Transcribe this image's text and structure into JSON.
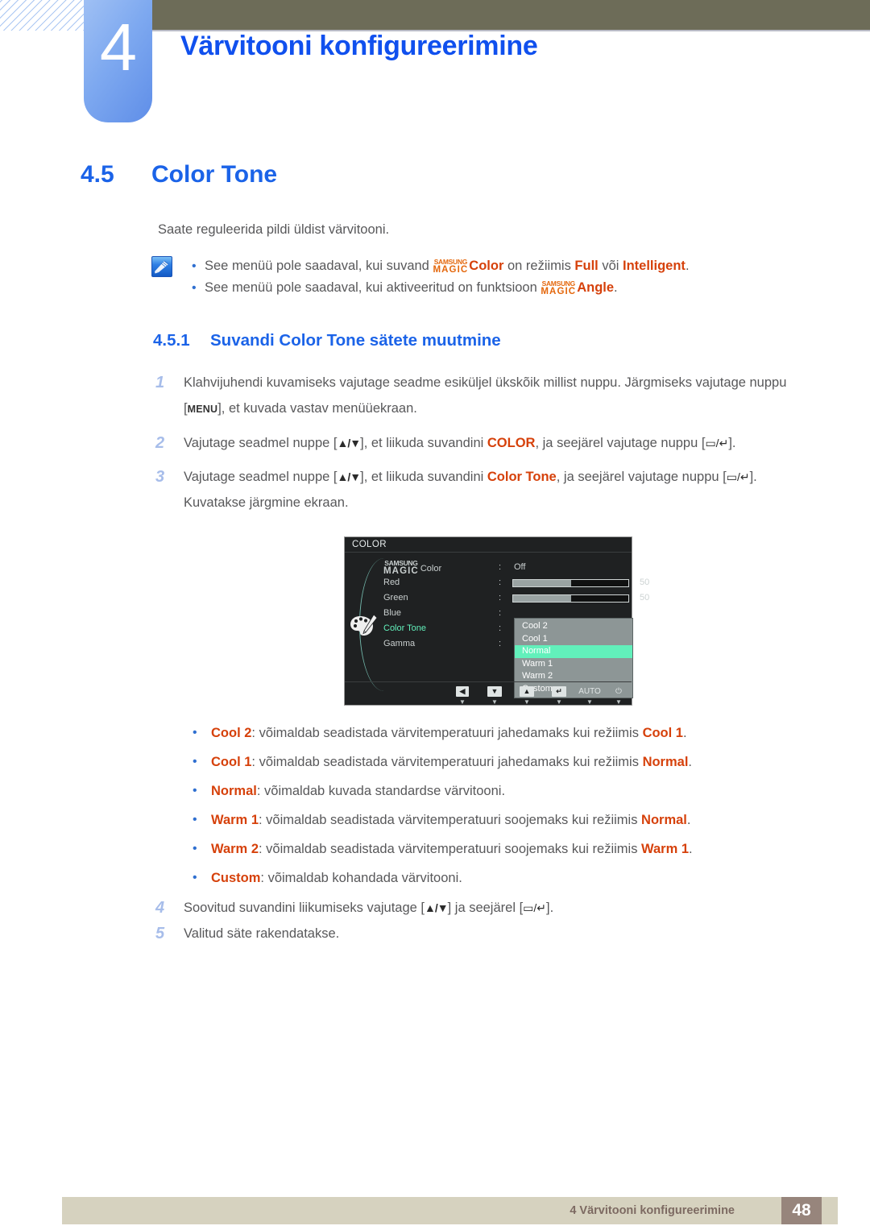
{
  "header": {
    "chapter_number": "4",
    "chapter_title": "Värvitooni konfigureerimine",
    "accent_blue": "#1050ee",
    "tab_blue": "#7ea9f0",
    "olive": "#6d6c58"
  },
  "section": {
    "number": "4.5",
    "title": "Color Tone",
    "intro": "Saate reguleerida pildi üldist värvitooni."
  },
  "note": {
    "icon": "note-pencil-icon",
    "lines": [
      {
        "pre": "See menüü pole saadaval, kui suvand ",
        "magic_top": "SAMSUNG",
        "magic_bottom": "MAGIC",
        "magic_suffix": "Color",
        "mid": " on režiimis ",
        "kw1": "Full",
        "mid2": " või ",
        "kw2": "Intelligent",
        "post": "."
      },
      {
        "pre": "See menüü pole saadaval, kui aktiveeritud on funktsioon ",
        "magic_top": "SAMSUNG",
        "magic_bottom": "MAGIC",
        "magic_suffix": "Angle",
        "post": "."
      }
    ]
  },
  "subsection": {
    "number": "4.5.1",
    "title": "Suvandi Color Tone sätete muutmine"
  },
  "steps": [
    {
      "num": "1",
      "part1": "Klahvijuhendi kuvamiseks vajutage seadme esiküljel ükskõik millist nuppu. Järgmiseks vajutage nuppu [",
      "key": "MENU",
      "part2": "], et kuvada vastav menüüekraan."
    },
    {
      "num": "2",
      "part1": "Vajutage seadmel nuppe [",
      "keys": "▲/▼",
      "part2": "], et liikuda suvandini ",
      "kw": "COLOR",
      "part3": ", ja seejärel vajutage nuppu [",
      "keys2": "▭/↵",
      "part4": "]."
    },
    {
      "num": "3",
      "part1": "Vajutage seadmel nuppe [",
      "keys": "▲/▼",
      "part2": "], et liikuda suvandini ",
      "kw": "Color Tone",
      "part3": ", ja seejärel vajutage nuppu [",
      "keys2": "▭/↵",
      "part4": "]. Kuvatakse järgmine ekraan."
    },
    {
      "num": "4",
      "part1": "Soovitud suvandini liikumiseks vajutage [",
      "keys": "▲/▼",
      "part2": "] ja seejärel [",
      "keys2": "▭/↵",
      "part3": "]."
    },
    {
      "num": "5",
      "part1": "Valitud säte rakendatakse."
    }
  ],
  "osd": {
    "title": "COLOR",
    "icon": "palette-icon",
    "rows": [
      {
        "magic_top": "SAMSUNG",
        "magic_bottom": "MAGIC",
        "label": "Color",
        "colon": ":",
        "value": "Off",
        "type": "text"
      },
      {
        "label": "Red",
        "colon": ":",
        "value": "50",
        "type": "slider",
        "fill_pct": 50
      },
      {
        "label": "Green",
        "colon": ":",
        "value": "50",
        "type": "slider",
        "fill_pct": 50
      },
      {
        "label": "Blue",
        "colon": ":",
        "value": "",
        "type": "text"
      },
      {
        "label": "Color Tone",
        "colon": ":",
        "value": "",
        "type": "text",
        "active": true
      },
      {
        "label": "Gamma",
        "colon": ":",
        "value": "",
        "type": "text"
      }
    ],
    "dropdown": {
      "items": [
        "Cool 2",
        "Cool 1",
        "Normal",
        "Warm 1",
        "Warm 2",
        "Custom"
      ],
      "selected": "Normal",
      "highlight_color": "#62f0bb"
    },
    "buttons": [
      {
        "label": "◀",
        "name": "osd-left-button",
        "style": "cap"
      },
      {
        "label": "▼",
        "name": "osd-down-button",
        "style": "cap"
      },
      {
        "label": "▲",
        "name": "osd-up-button",
        "style": "cap"
      },
      {
        "label": "↵",
        "name": "osd-enter-button",
        "style": "cap"
      },
      {
        "label": "AUTO",
        "name": "osd-auto-button",
        "style": "plain"
      },
      {
        "label": "⏻",
        "name": "osd-power-button",
        "style": "plain"
      }
    ]
  },
  "options": [
    {
      "kw": "Cool 2",
      "mid": ": võimaldab seadistada värvitemperatuuri jahedamaks kui režiimis ",
      "kw2": "Cool 1",
      "post": "."
    },
    {
      "kw": "Cool 1",
      "mid": ": võimaldab seadistada värvitemperatuuri jahedamaks kui režiimis ",
      "kw2": "Normal",
      "post": "."
    },
    {
      "kw": "Normal",
      "mid": ": võimaldab kuvada standardse värvitooni.",
      "kw2": "",
      "post": ""
    },
    {
      "kw": "Warm 1",
      "mid": ": võimaldab seadistada värvitemperatuuri soojemaks kui režiimis ",
      "kw2": "Normal",
      "post": "."
    },
    {
      "kw": "Warm 2",
      "mid": ": võimaldab seadistada värvitemperatuuri soojemaks kui režiimis ",
      "kw2": "Warm 1",
      "post": "."
    },
    {
      "kw": "Custom",
      "mid": ": võimaldab kohandada värvitooni.",
      "kw2": "",
      "post": ""
    }
  ],
  "footer": {
    "text": "4 Värvitooni konfigureerimine",
    "page": "48"
  }
}
